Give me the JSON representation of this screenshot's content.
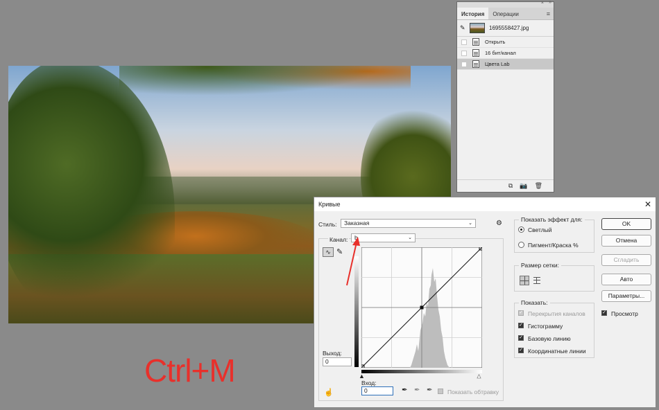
{
  "hotkey": "Ctrl+M",
  "history": {
    "tabs": [
      "История",
      "Операции"
    ],
    "snapshot": "1695558427.jpg",
    "steps": [
      "Открыть",
      "16 бит/канал",
      "Цвета Lab"
    ],
    "selected_index": 2
  },
  "curves": {
    "title": "Кривые",
    "style_label": "Стиль:",
    "style_value": "Заказная",
    "channel_label": "Канал:",
    "channel_value": "b",
    "output_label": "Выход:",
    "output_value": "0",
    "input_label": "Вход:",
    "input_value": "0",
    "show_clipping": "Показать обтравку",
    "effect_group": "Показать эффект для:",
    "effect_light": "Светлый",
    "effect_pigment": "Пигмент/Краска %",
    "grid_group": "Размер сетки:",
    "show_group": "Показать:",
    "show_options": [
      "Перекрытия каналов",
      "Гистограмму",
      "Базовую линию",
      "Координатные линии"
    ],
    "show_states": [
      "disabled",
      "on",
      "on",
      "on"
    ],
    "buttons": [
      "OK",
      "Отмена",
      "Сгладить",
      "Авто",
      "Параметры..."
    ],
    "preview_label": "Просмотр",
    "accent_arrow": "#e8302b"
  }
}
